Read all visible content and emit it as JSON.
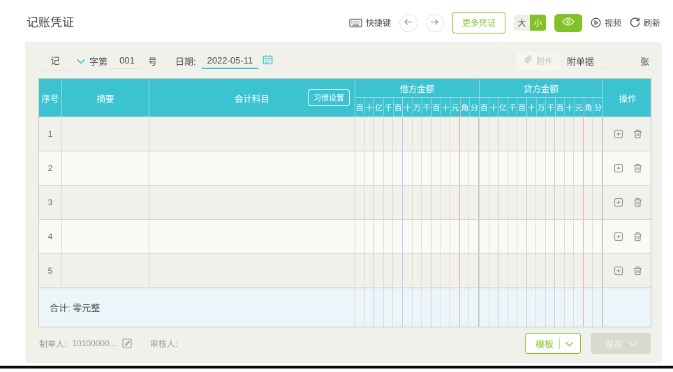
{
  "page": {
    "title": "记账凭证"
  },
  "colors": {
    "accent_green": "#82c226",
    "accent_teal": "#3cc3d2",
    "total_row_blue": "#ebf5fa",
    "grid_thousand_separator": "#cdc5e8",
    "grid_yuan_separator": "#eaa9a2"
  },
  "toolbar": {
    "shortcut_label": "快捷键",
    "more_vouchers_label": "更多凭证",
    "size_large_label": "大",
    "size_small_label": "小",
    "size_selected": "小",
    "video_label": "视频",
    "refresh_label": "刷新"
  },
  "voucher_meta": {
    "word_value": "记",
    "zi_di_label": "字第",
    "number_value": "001",
    "hao_label": "号",
    "date_label": "日期:",
    "date_value": "2022-05-11",
    "attachment_button_label": "附件",
    "attached_docs_label": "附单据",
    "attached_docs_value": "",
    "unit_label": "张"
  },
  "table": {
    "headers": {
      "index": "序号",
      "summary": "摘要",
      "account": "会计科目",
      "habit_button": "习惯设置",
      "debit": "借方金额",
      "credit": "贷方金额",
      "actions": "操作"
    },
    "digit_labels": [
      "百",
      "十",
      "亿",
      "千",
      "百",
      "十",
      "万",
      "千",
      "百",
      "十",
      "元",
      "角",
      "分"
    ],
    "rows": [
      {
        "index": "1",
        "summary": "",
        "account": "",
        "debit": "",
        "credit": ""
      },
      {
        "index": "2",
        "summary": "",
        "account": "",
        "debit": "",
        "credit": ""
      },
      {
        "index": "3",
        "summary": "",
        "account": "",
        "debit": "",
        "credit": ""
      },
      {
        "index": "4",
        "summary": "",
        "account": "",
        "debit": "",
        "credit": ""
      },
      {
        "index": "5",
        "summary": "",
        "account": "",
        "debit": "",
        "credit": ""
      }
    ],
    "total_label": "合计: 零元整"
  },
  "footer": {
    "preparer_label": "制单人:",
    "preparer_value": "10100000...",
    "reviewer_label": "审核人:",
    "template_button_label": "模板",
    "save_button_label": "保存"
  }
}
